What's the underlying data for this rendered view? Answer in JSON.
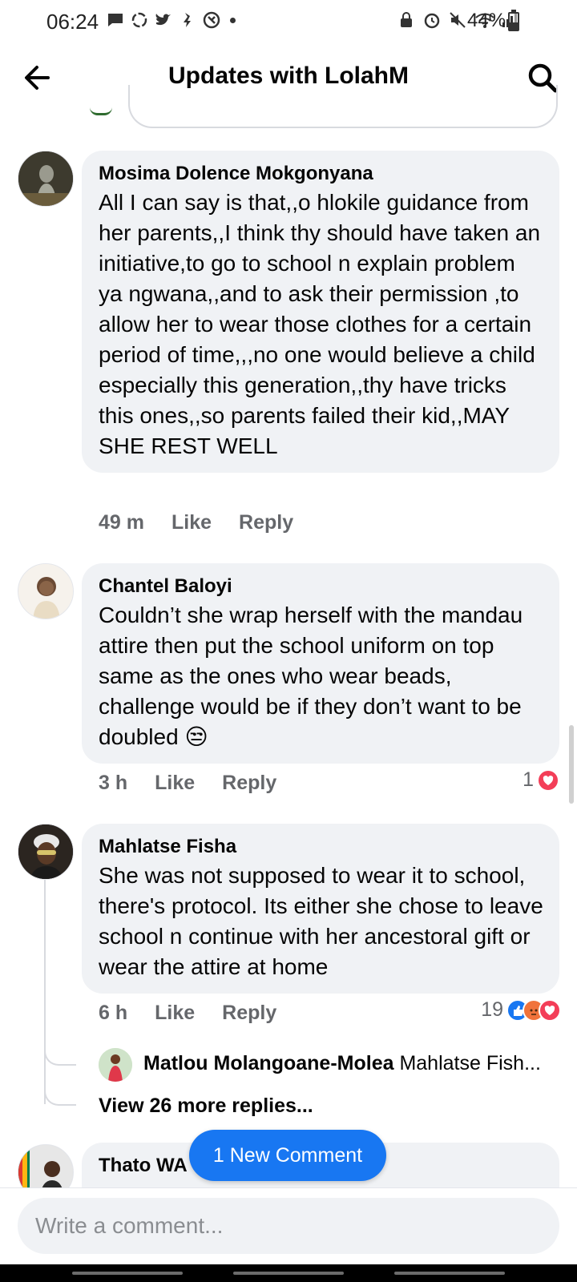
{
  "status_bar": {
    "time": "06:24",
    "battery": "44%",
    "left_icons": [
      "message-icon",
      "messenger-icon",
      "twitter-icon",
      "notification-icon",
      "whatsapp-icon"
    ],
    "right_icons": [
      "lock-icon",
      "alarm-icon",
      "mute-icon",
      "wifi-icon",
      "signal-icon",
      "battery-icon"
    ]
  },
  "header": {
    "title": "Updates with LolahM",
    "back_icon": "arrow-left-icon",
    "search_icon": "search-icon"
  },
  "comments": [
    {
      "author": "Mosima Dolence Mokgonyana",
      "text": "All I can say is that,,o hlokile guidance from her parents,,I think thy should have taken an initiative,to go to school n explain problem ya ngwana,,and to ask their permission ,to allow her to wear those clothes for a certain period of time,,,no one would believe a child especially this generation,,thy have tricks this ones,,so parents failed their kid,,MAY SHE REST WELL",
      "time": "49 m",
      "like": "Like",
      "reply": "Reply"
    },
    {
      "author": "Chantel Baloyi",
      "text": "Couldn’t she wrap herself with the mandau attire then put the school uniform on top same as the ones who wear beads, challenge would be if they don’t want to be doubled",
      "emoji": "😒",
      "time": "3 h",
      "like": "Like",
      "reply": "Reply",
      "reaction_count": "1"
    },
    {
      "author": "Mahlatse Fisha",
      "text": "She was not supposed to wear it to school, there's protocol. Its either she chose to leave school n continue with her ancestoral gift or wear the attire at home",
      "time": "6 h",
      "like": "Like",
      "reply": "Reply",
      "reaction_count": "19"
    },
    {
      "author": "Thato WA"
    }
  ],
  "reply_preview": {
    "author": "Matlou Molangoane-Molea",
    "snippet": "Mahlatse Fish..."
  },
  "view_more": "View 26 more replies...",
  "new_comment_pill": "1 New Comment",
  "composer": {
    "placeholder": "Write a comment..."
  },
  "colors": {
    "accent": "#1877f2",
    "bubble": "#f0f2f5",
    "secondary_text": "#65676b",
    "love": "#f33e58",
    "angry": "#f0733b"
  }
}
